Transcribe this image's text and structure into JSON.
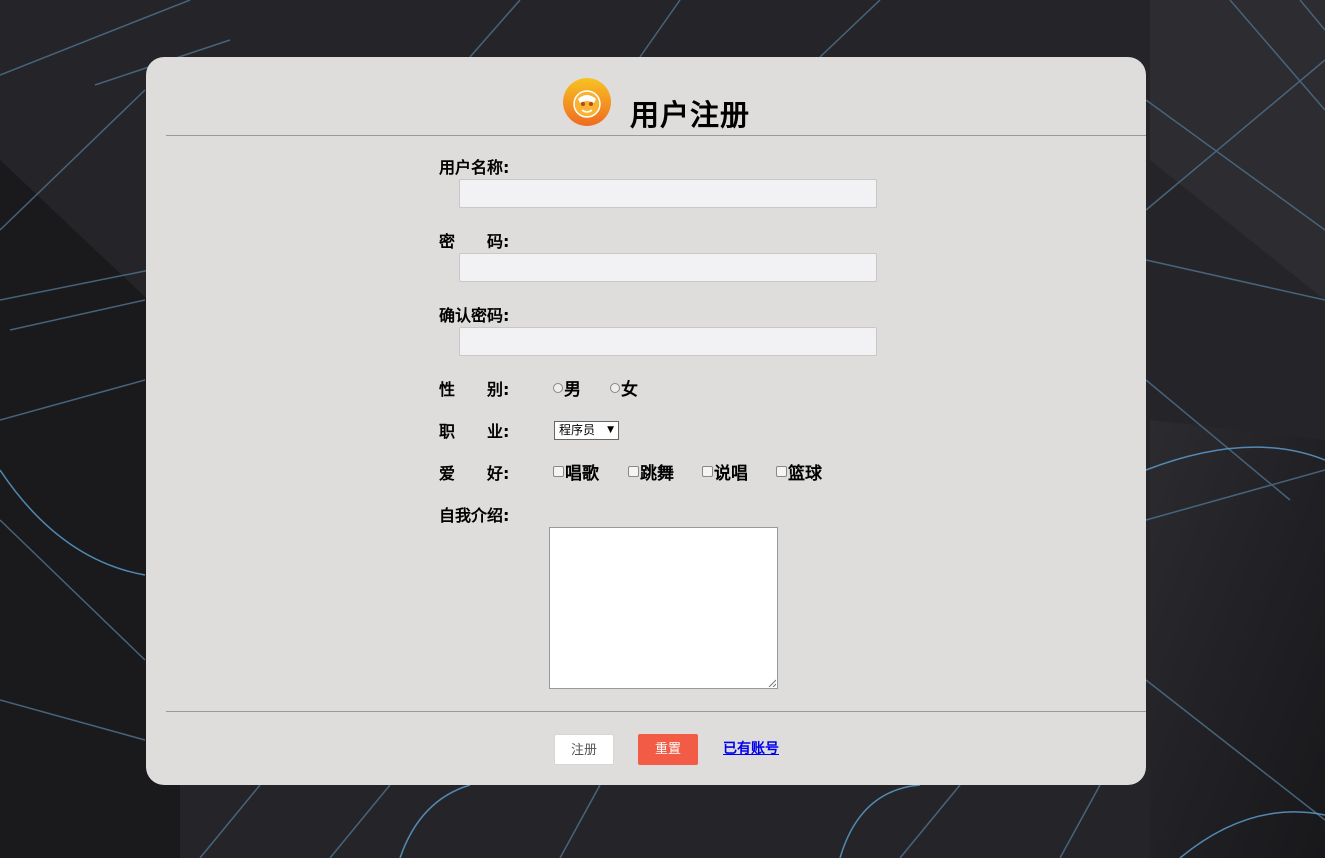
{
  "form": {
    "title": "用户注册",
    "username_label": "用户名称:",
    "password_label": "密　　码:",
    "confirm_label": "确认密码:",
    "gender_label": "性　　别:",
    "gender_options": [
      "男",
      "女"
    ],
    "job_label": "职　　业:",
    "job_selected": "程序员",
    "hobby_label": "爱　　好:",
    "hobbies": [
      "唱歌",
      "跳舞",
      "说唱",
      "篮球"
    ],
    "intro_label": "自我介绍:",
    "submit_label": "注册",
    "reset_label": "重置",
    "login_link": "已有账号"
  },
  "icons": {
    "logo": "monkey-logo-icon",
    "select_arrow": "chevron-down-icon"
  },
  "colors": {
    "card": "#dedddb",
    "reset_button": "#f25b45",
    "link": "#0000ee",
    "background": "#222226"
  }
}
